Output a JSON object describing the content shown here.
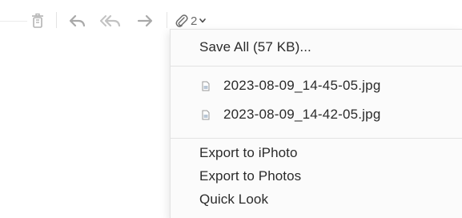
{
  "toolbar": {
    "buttons": [
      {
        "icon": "trash-icon"
      },
      {
        "icon": "reply-icon"
      },
      {
        "icon": "reply-all-icon"
      },
      {
        "icon": "forward-icon"
      }
    ],
    "attachments": {
      "icon": "paperclip-icon",
      "count": "2",
      "chevron": "chevron-down-icon"
    },
    "icon_color": "#a9a9a9"
  },
  "menu": {
    "save_all_label": "Save All (57 KB)...",
    "files": [
      {
        "name": "2023-08-09_14-45-05.jpg",
        "icon": "image-file-icon"
      },
      {
        "name": "2023-08-09_14-42-05.jpg",
        "icon": "image-file-icon"
      }
    ],
    "actions": [
      {
        "label": "Export to iPhoto"
      },
      {
        "label": "Export to Photos"
      },
      {
        "label": "Quick Look"
      }
    ],
    "background": "#fbfbfb",
    "text_color": "#2b2b2b"
  }
}
